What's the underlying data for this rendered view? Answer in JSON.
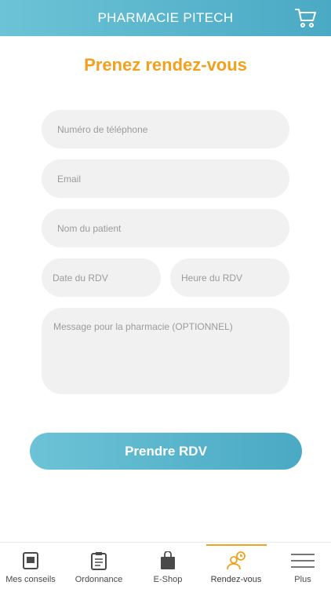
{
  "header": {
    "title": "PHARMACIE PITECH",
    "cart_icon": "cart-icon"
  },
  "page": {
    "title": "Prenez rendez-vous"
  },
  "form": {
    "phone_placeholder": "Numéro de téléphone",
    "email_placeholder": "Email",
    "patient_placeholder": "Nom du patient",
    "date_placeholder": "Date du RDV",
    "time_placeholder": "Heure du RDV",
    "message_placeholder": "Message pour la pharmacie (OPTIONNEL)",
    "submit_label": "Prendre RDV"
  },
  "tabs": [
    {
      "label": "Mes conseils",
      "icon": "book-icon"
    },
    {
      "label": "Ordonnance",
      "icon": "clipboard-icon"
    },
    {
      "label": "E-Shop",
      "icon": "shopping-bag-icon"
    },
    {
      "label": "Rendez-vous",
      "icon": "appointment-icon",
      "active": true
    },
    {
      "label": "Plus",
      "icon": "menu-icon"
    }
  ],
  "colors": {
    "accent": "#f0a11e",
    "primary": "#4aa9c4",
    "field_bg": "#f1f1f1"
  }
}
